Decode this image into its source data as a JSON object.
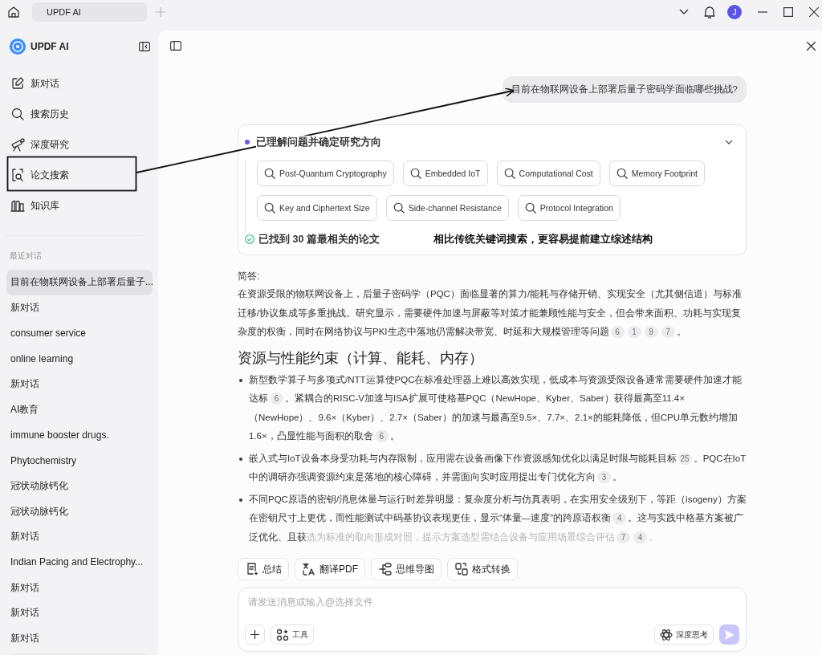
{
  "tabbar": {
    "tabs": [
      {
        "label": "UPDF AI",
        "selected": true
      }
    ],
    "avatar": "J"
  },
  "sidebar": {
    "brand": "UPDF AI",
    "nav": [
      {
        "label": "新对话"
      },
      {
        "label": "搜索历史"
      },
      {
        "label": "深度研究"
      },
      {
        "label": "论文搜索"
      },
      {
        "label": "知识库"
      }
    ],
    "recent_label": "最近对话",
    "recent": [
      {
        "title": "目前在物联网设备上部署后量子...",
        "selected": true
      },
      {
        "title": "新对话",
        "selected": false
      },
      {
        "title": "consumer service",
        "selected": false
      },
      {
        "title": "online learning",
        "selected": false
      },
      {
        "title": "新对话",
        "selected": false
      },
      {
        "title": "AI教育",
        "selected": false
      },
      {
        "title": "immune booster drugs.",
        "selected": false
      },
      {
        "title": "Phytochemistry",
        "selected": false
      },
      {
        "title": "冠状动脉钙化",
        "selected": false
      },
      {
        "title": "冠状动脉钙化",
        "selected": false
      },
      {
        "title": "新对话",
        "selected": false
      },
      {
        "title": "Indian Pacing and Electrophy...",
        "selected": false
      },
      {
        "title": "新对话",
        "selected": false
      },
      {
        "title": "新对话",
        "selected": false
      },
      {
        "title": "新对话",
        "selected": false
      }
    ]
  },
  "chat": {
    "question": "目前在物联网设备上部署后量子密码学面临哪些挑战?",
    "research": {
      "step": "已理解问题并确定研究方向",
      "expanded": true,
      "keywords": [
        "Post-Quantum Cryptography",
        "Embedded IoT",
        "Computational Cost",
        "Memory Footprint",
        "Key and Ciphertext Size",
        "Side-channel Resistance",
        "Protocol Integration"
      ],
      "result": "已找到 30 篇最相关的论文"
    },
    "annotation": {
      "caption": "相比传统关键词搜索，更容易提前建立综述结构"
    },
    "answer": {
      "label": "简答:",
      "summary": [
        {
          "kind": "text",
          "text": "在资源受限的物联网设备上，后量子密码学（PQC）面临显著的算力/能耗与存储开销、实现安全（尤其侧信道）与标准迁移/协议集成等多重挑战。研究显示，需要硬件加速与屏蔽等对策才能兼顾性能与安全，但会带来面积、功耗与实现复杂度的权衡，同时在网络协议与PKI生态中落地仍需解决带宽、时延和大规模管理等问题"
        },
        {
          "kind": "cite",
          "text": "6"
        },
        {
          "kind": "cite",
          "text": "1"
        },
        {
          "kind": "cite",
          "text": "9"
        },
        {
          "kind": "cite",
          "text": "7"
        },
        {
          "kind": "text",
          "text": "。"
        }
      ],
      "section_title": "资源与性能约束（计算、能耗、内存）",
      "bullets": [
        [
          {
            "kind": "text",
            "text": "新型数学算子与多项式/NTT运算使PQC在标准处理器上难以高效实现，低成本与资源受限设备通常需要硬件加速才能达标"
          },
          {
            "kind": "cite",
            "text": "6"
          },
          {
            "kind": "text",
            "text": "。紧耦合的RISC-V加速与ISA扩展可使格基PQC（NewHope、Kyber、Saber）获得最高至11.4×（NewHope）、9.6×（Kyber）、2.7×（Saber）的加速与最高至9.5×、7.7×、2.1×的能耗降低，但CPU单元数约增加1.6×，凸显性能与面积的取舍"
          },
          {
            "kind": "cite",
            "text": "6"
          },
          {
            "kind": "text",
            "text": "。"
          }
        ],
        [
          {
            "kind": "text",
            "text": "嵌入式与IoT设备本身受功耗与内存限制，应用需在设备画像下作资源感知优化以满足时限与能耗目标"
          },
          {
            "kind": "cite",
            "text": "25"
          },
          {
            "kind": "text",
            "text": "。PQC在IoT中的调研亦强调资源约束是落地的核心障碍，并需面向实时应用提出专门优化方向"
          },
          {
            "kind": "cite",
            "text": "3"
          },
          {
            "kind": "text",
            "text": "。"
          }
        ],
        [
          {
            "kind": "text",
            "text": "不同PQC原语的密钥/消息体量与运行时差异明显：复杂度分析与仿真表明，在实用安全级别下，等距（isogeny）方案在密钥尺寸上更优，而性能测试中码基协议表现更佳，显示“体量—速度”的跨原语权衡"
          },
          {
            "kind": "cite",
            "text": "4"
          },
          {
            "kind": "text",
            "text": "。这与实践中格基方案被广泛优化、且获"
          },
          {
            "kind": "faded",
            "text": "选为标准的取向形成对照，提示方案选型需结合设备与应用场景综合评估"
          },
          {
            "kind": "cite",
            "text": "7"
          },
          {
            "kind": "cite",
            "text": "4"
          },
          {
            "kind": "faded",
            "text": "。"
          }
        ]
      ]
    },
    "quick_actions": [
      {
        "label": "总结"
      },
      {
        "label": "翻译PDF"
      },
      {
        "label": "思维导图"
      },
      {
        "label": "格式转换"
      }
    ],
    "composer": {
      "placeholder": "请发送消息或输入@选择文件",
      "tools": "工具",
      "deep_think": "深度思考"
    }
  }
}
